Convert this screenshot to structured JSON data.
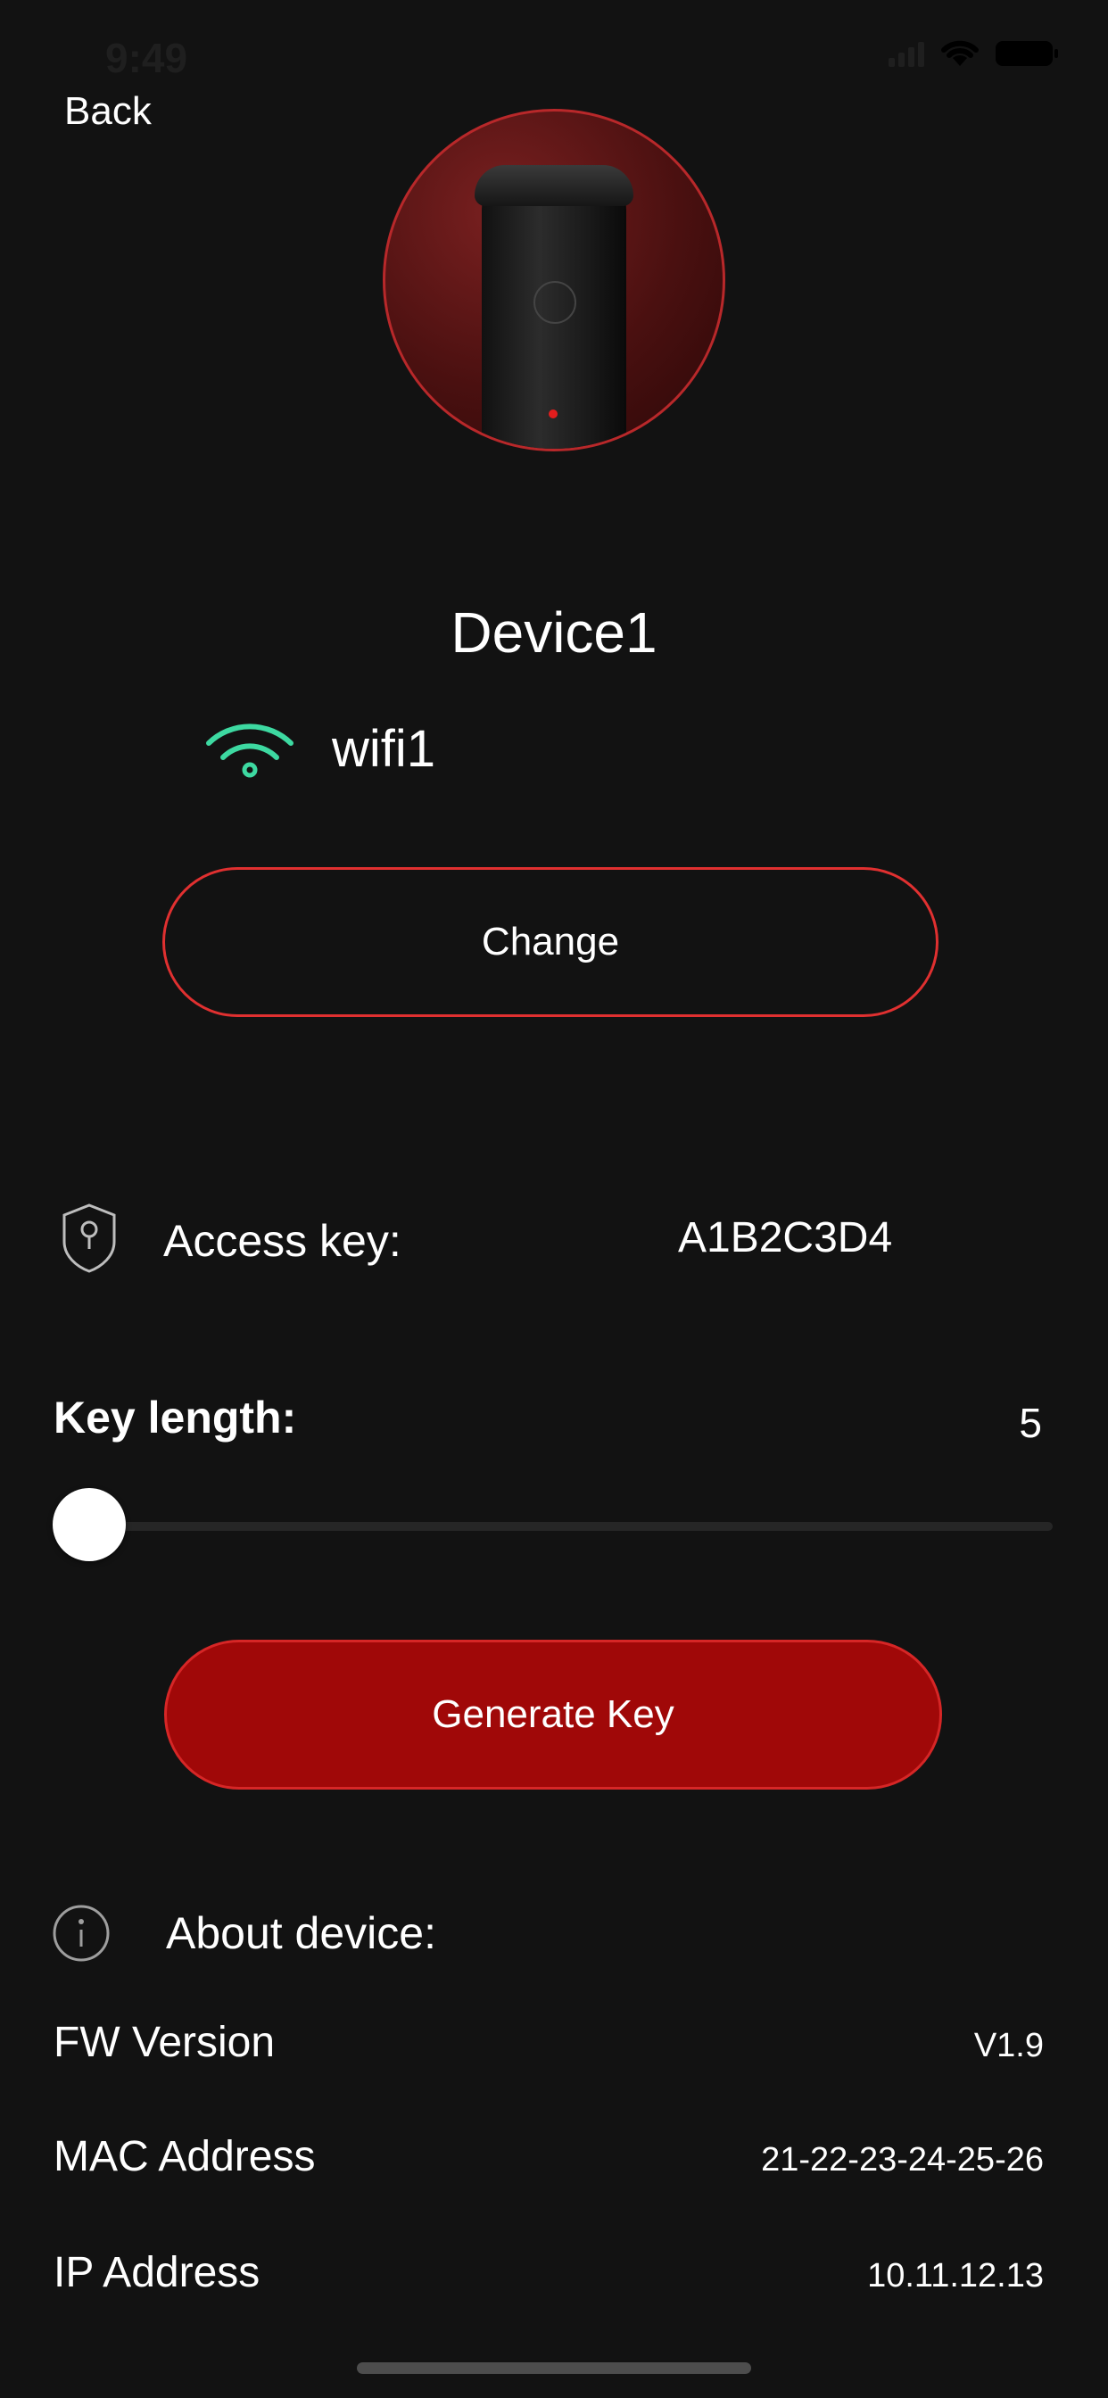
{
  "status_bar": {
    "time": "9:49"
  },
  "nav": {
    "back_label": "Back"
  },
  "device": {
    "name": "Device1",
    "image_icon": "device-product-image"
  },
  "wifi": {
    "name": "wifi1",
    "icon": "wifi-icon",
    "color": "#3dd9a1"
  },
  "change_button": {
    "label": "Change"
  },
  "access_key": {
    "icon": "shield-key-icon",
    "label": "Access key:",
    "value": "A1B2C3D4"
  },
  "key_length": {
    "label": "Key length:",
    "value": "5",
    "slider_fraction": 0.0
  },
  "generate_button": {
    "label": "Generate Key"
  },
  "about": {
    "icon": "info-icon",
    "label": "About device:",
    "rows": [
      {
        "label": "FW Version",
        "value": "V1.9"
      },
      {
        "label": "MAC Address",
        "value": "21-22-23-24-25-26"
      },
      {
        "label": "IP Address",
        "value": "10.11.12.13"
      }
    ]
  },
  "colors": {
    "background": "#121212",
    "accent": "#e03030",
    "generate_fill": "#a00808"
  }
}
